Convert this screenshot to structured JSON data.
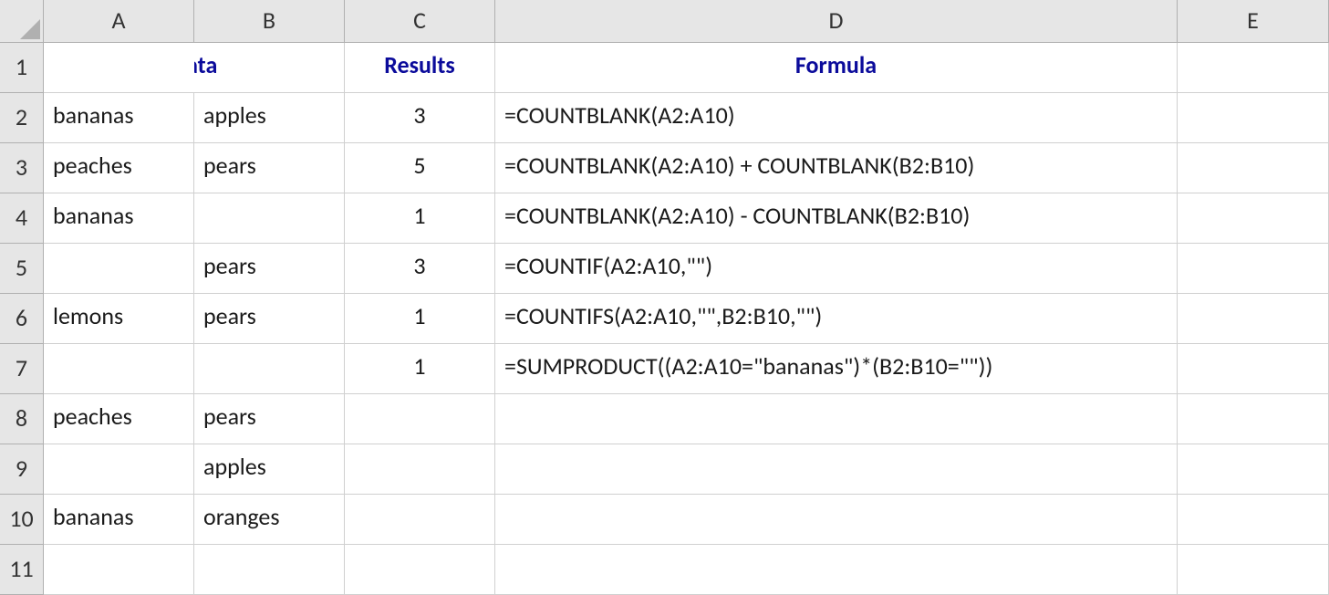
{
  "columns": [
    "A",
    "B",
    "C",
    "D",
    "E"
  ],
  "row_numbers": [
    "1",
    "2",
    "3",
    "4",
    "5",
    "6",
    "7",
    "8",
    "9",
    "10",
    "11"
  ],
  "headers": {
    "data": "Data",
    "results": "Results",
    "formula": "Formula"
  },
  "cells": {
    "A2": "bananas",
    "B2": "apples",
    "C2": "3",
    "D2": "=COUNTBLANK(A2:A10)",
    "A3": "peaches",
    "B3": "pears",
    "C3": "5",
    "D3": "=COUNTBLANK(A2:A10) + COUNTBLANK(B2:B10)",
    "A4": "bananas",
    "B4": "",
    "C4": "1",
    "D4": "=COUNTBLANK(A2:A10) - COUNTBLANK(B2:B10)",
    "A5": "",
    "B5": "pears",
    "C5": "3",
    "D5": "=COUNTIF(A2:A10,\"\")",
    "A6": "lemons",
    "B6": "pears",
    "C6": "1",
    "D6": "=COUNTIFS(A2:A10,\"\",B2:B10,\"\")",
    "A7": "",
    "B7": "",
    "C7": "1",
    "D7": "=SUMPRODUCT((A2:A10=\"bananas\")*(B2:B10=\"\"))",
    "A8": "peaches",
    "B8": "pears",
    "C8": "",
    "D8": "",
    "A9": "",
    "B9": "apples",
    "C9": "",
    "D9": "",
    "A10": "bananas",
    "B10": "oranges",
    "C10": "",
    "D10": ""
  }
}
